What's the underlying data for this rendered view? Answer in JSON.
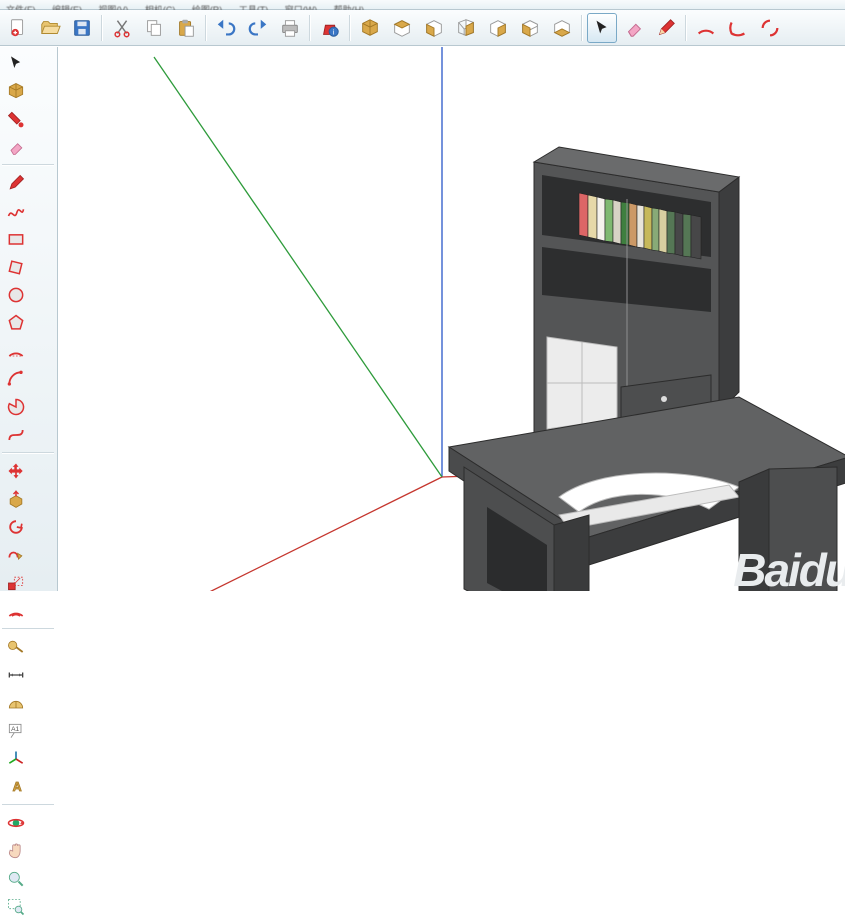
{
  "menu": {
    "items": [
      "文件(F)",
      "编辑(E)",
      "视图(V)",
      "相机(C)",
      "绘图(R)",
      "工具(T)",
      "窗口(W)",
      "帮助(H)"
    ]
  },
  "top_tb": {
    "new": "new-doc-icon",
    "open": "open-folder-icon",
    "save": "save-disk-icon",
    "cut": "cut-icon",
    "copy": "copy-icon",
    "paste": "paste-icon",
    "undo": "undo-icon",
    "redo": "redo-icon",
    "print": "print-icon",
    "info": "model-info-icon",
    "iso": "iso-view-icon",
    "top": "top-view-icon",
    "front": "front-view-icon",
    "right": "right-view-icon",
    "back": "back-view-icon",
    "left": "left-view-icon",
    "under": "bottom-view-icon",
    "cursor": "select-icon",
    "eraser": "eraser-icon",
    "pen": "pencil-icon",
    "poly": "arc-tool-icon",
    "arc2": "arc2-icon",
    "arc3": "arc3-icon"
  },
  "left_tb": {
    "select": "select-icon",
    "component": "component-icon",
    "brush": "paint-brush-icon",
    "eraser": "eraser-icon",
    "pen": "pencil-icon",
    "freehand": "freehand-icon",
    "rect": "rect-icon",
    "rotrect": "rotated-rect-icon",
    "circle": "circle-icon",
    "polygon": "polygon-icon",
    "arc1": "arc-icon",
    "arc2": "arc-2pt-icon",
    "arc3": "pie-icon",
    "bezier": "curve-icon",
    "move": "move-icon",
    "pushpull": "pushpull-icon",
    "rotate": "rotate-icon",
    "followme": "followme-icon",
    "scale": "scale-icon",
    "offset": "offset-icon",
    "tape": "tape-icon",
    "dim": "dimension-icon",
    "prot": "protractor-icon",
    "text": "text-icon",
    "axes": "axes-icon",
    "3dtext": "3dtext-icon",
    "orbit": "orbit-icon",
    "pan": "pan-icon",
    "mag": "zoom-icon",
    "zoomwin": "zoom-window-icon"
  },
  "watermark": "Baidu"
}
